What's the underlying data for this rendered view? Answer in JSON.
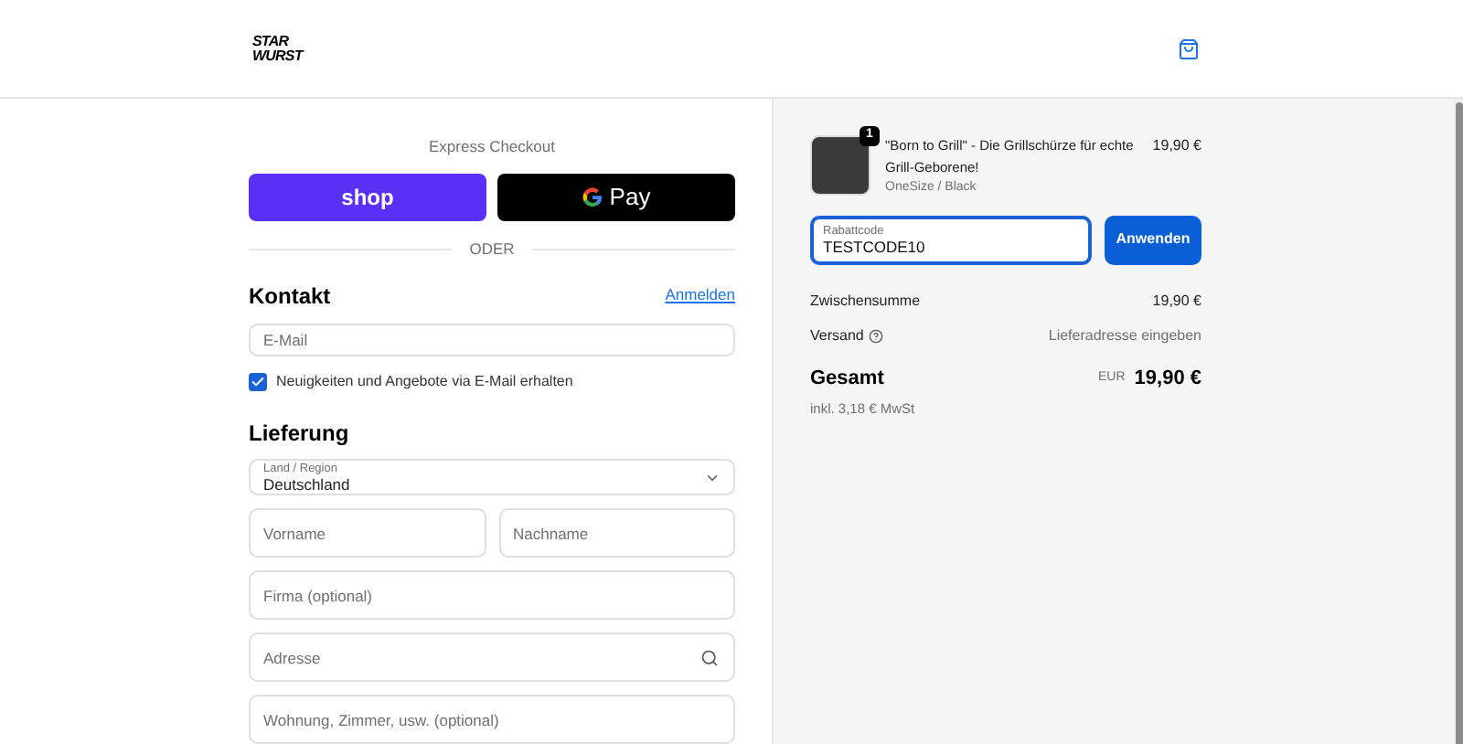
{
  "header": {
    "logo": [
      "STAR",
      "WURST"
    ]
  },
  "express": {
    "title": "Express Checkout",
    "buttons": [
      {
        "kind": "shop",
        "label": "shop"
      },
      {
        "kind": "gpay",
        "label": "Pay"
      }
    ],
    "divider": "ODER"
  },
  "contact": {
    "title": "Kontakt",
    "login": "Anmelden",
    "email": {
      "placeholder": "E-Mail"
    },
    "newsletter": {
      "label": "Neuigkeiten und Angebote via E-Mail erhalten",
      "checked": true
    }
  },
  "delivery": {
    "title": "Lieferung",
    "country": {
      "label": "Land / Region",
      "value": "Deutschland"
    },
    "fields": [
      {
        "placeholder": "Vorname",
        "kind": "half"
      },
      {
        "placeholder": "Nachname",
        "kind": "half"
      },
      {
        "placeholder": "Firma (optional)",
        "kind": "full"
      },
      {
        "placeholder": "Adresse",
        "kind": "search"
      },
      {
        "placeholder": "Wohnung, Zimmer, usw. (optional)",
        "kind": "full"
      }
    ]
  },
  "cart": {
    "items": [
      {
        "quantity": "1",
        "title": "\"Born to Grill\" - Die Grillschürze für echte Grill-Geborene!",
        "variant": "OneSize / Black",
        "price": "19,90 €"
      }
    ],
    "discount": {
      "label": "Rabattcode",
      "value": "TESTCODE10",
      "button": "Anwenden"
    },
    "lines": [
      {
        "label": "Zwischensumme",
        "value": "19,90 €",
        "info": false
      },
      {
        "label": "Versand",
        "value": "Lieferadresse eingeben",
        "info": true
      }
    ],
    "total": {
      "label": "Gesamt",
      "currency": "EUR",
      "amount": "19,90 €",
      "tax": "inkl. 3,18 € MwSt"
    }
  }
}
